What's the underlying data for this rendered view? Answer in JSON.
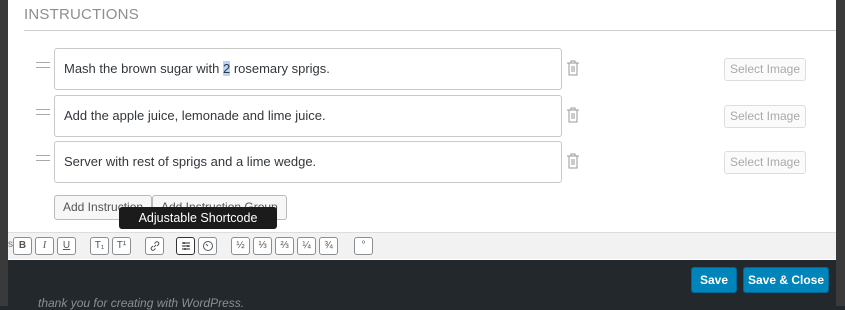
{
  "section": {
    "title": "INSTRUCTIONS"
  },
  "instructions": [
    {
      "pre": "Mash the brown sugar with ",
      "highlight": "2",
      "post": " rosemary sprigs."
    },
    {
      "pre": "Add the apple juice, lemonade and lime juice.",
      "highlight": "",
      "post": ""
    },
    {
      "pre": "Server with rest of sprigs and a lime wedge.",
      "highlight": "",
      "post": ""
    }
  ],
  "select_image_label": "Select Image",
  "buttons": {
    "add_instruction": "Add Instruction",
    "add_instruction_group": "Add Instruction Group"
  },
  "tooltip": "Adjustable Shortcode",
  "toolbar": {
    "bold": "B",
    "italic": "I",
    "underline": "U",
    "subscript": "T₁",
    "superscript": "T¹",
    "fractions": [
      "½",
      "⅓",
      "⅔",
      "¼",
      "¾"
    ],
    "degree": "°"
  },
  "footer": {
    "save": "Save",
    "save_close": "Save & Close"
  },
  "background_text": "thank you for creating with WordPress.",
  "colors": {
    "primary": "#0085ba",
    "highlight": "#b3d4fc"
  }
}
